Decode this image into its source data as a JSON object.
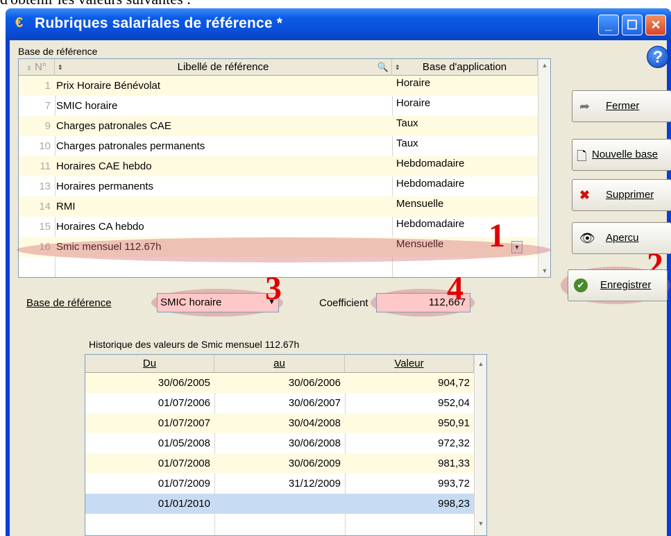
{
  "page": {
    "caption": "d'obtenir les valeurs suivantes :"
  },
  "window": {
    "title": "Rubriques salariales de référence *"
  },
  "grid_caption": "Base de référence",
  "grid": {
    "columns": [
      "N°",
      "Libellé de référence",
      "Base d'application"
    ],
    "rows": [
      {
        "num": "1",
        "libelle": "Prix Horaire Bénévolat",
        "base": "Horaire"
      },
      {
        "num": "7",
        "libelle": "SMIC horaire",
        "base": "Horaire"
      },
      {
        "num": "9",
        "libelle": "Charges patronales CAE",
        "base": "Taux"
      },
      {
        "num": "10",
        "libelle": "Charges patronales permanents",
        "base": "Taux"
      },
      {
        "num": "11",
        "libelle": "Horaires CAE hebdo",
        "base": "Hebdomadaire"
      },
      {
        "num": "13",
        "libelle": "Horaires permanents",
        "base": "Hebdomadaire"
      },
      {
        "num": "14",
        "libelle": "RMI",
        "base": "Mensuelle"
      },
      {
        "num": "15",
        "libelle": "Horaires CA hebdo",
        "base": "Hebdomadaire"
      },
      {
        "num": "16",
        "libelle": "Smic mensuel  112.67h",
        "base": "Mensuelle"
      }
    ],
    "selected_row": 8
  },
  "buttons": {
    "fermer": "Fermer",
    "nouvelle_base": "Nouvelle base",
    "supprimer": "Supprimer",
    "apercu": "Apercu",
    "enregistrer": "Enregistrer"
  },
  "form": {
    "base_label": "Base de référence",
    "base_value": "SMIC horaire",
    "coef_label": "Coefficient",
    "coef_value": "112,667"
  },
  "annotations": [
    "1",
    "2",
    "3",
    "4"
  ],
  "history": {
    "caption": "Historique des valeurs de  Smic mensuel  112.67h",
    "columns": [
      "Du",
      "au",
      "Valeur"
    ],
    "rows": [
      {
        "du": "30/06/2005",
        "au": "30/06/2006",
        "valeur": "904,72"
      },
      {
        "du": "01/07/2006",
        "au": "30/06/2007",
        "valeur": "952,04"
      },
      {
        "du": "01/07/2007",
        "au": "30/04/2008",
        "valeur": "950,91"
      },
      {
        "du": "01/05/2008",
        "au": "30/06/2008",
        "valeur": "972,32"
      },
      {
        "du": "01/07/2008",
        "au": "30/06/2009",
        "valeur": "981,33"
      },
      {
        "du": "01/07/2009",
        "au": "31/12/2009",
        "valeur": "993,72"
      },
      {
        "du": "01/01/2010",
        "au": "",
        "valeur": "998,23"
      }
    ]
  }
}
